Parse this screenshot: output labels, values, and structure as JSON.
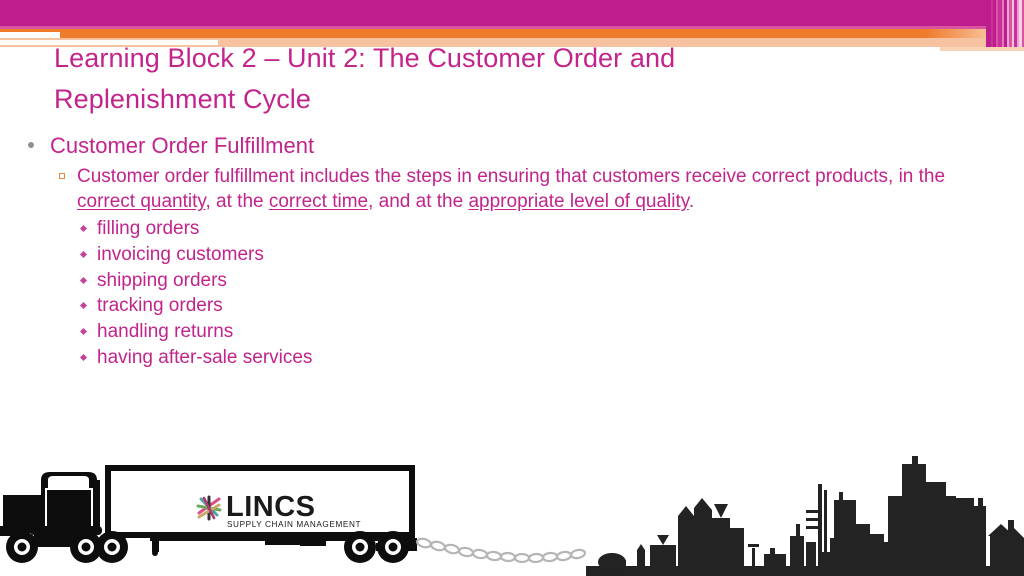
{
  "slide": {
    "title": "Learning Block 2 – Unit 2: The Customer Order and Replenishment Cycle",
    "title_color": "#C2248C"
  },
  "header": {
    "band_magenta_color": "#BE1E8D",
    "band_orange_color": "#EE7C2B",
    "band_peach_color": "#F6C2A0",
    "stripe_colors": [
      "#BE1E8D",
      "#C9309B",
      "#BE1E8D",
      "#D9559F",
      "#C9309B",
      "#E27DB8",
      "#BE1E8D",
      "#EFA9D0",
      "#D9559F",
      "#F3C2DF",
      "#C9309B",
      "#E9A0CC",
      "#F5D2E7",
      "#D9559F"
    ]
  },
  "content": {
    "level1": [
      {
        "text": "Customer Order Fulfillment",
        "bullet": "dot-bullet"
      }
    ],
    "level2": {
      "bullet": "square-bullet",
      "segments": [
        {
          "text": "Customer order fulfillment includes the steps in ensuring that customers receive correct products, in the ",
          "underline": false
        },
        {
          "text": "correct quantity",
          "underline": true
        },
        {
          "text": ", at the ",
          "underline": false
        },
        {
          "text": "correct time",
          "underline": true
        },
        {
          "text": ", and at the ",
          "underline": false
        },
        {
          "text": "appropriate level of quality",
          "underline": true
        },
        {
          "text": ".",
          "underline": false
        }
      ]
    },
    "level3": {
      "bullet": "diamond-bullet",
      "items": [
        "filling orders",
        "invoicing customers",
        "shipping orders",
        "tracking orders",
        "handling returns",
        "having after-sale services"
      ]
    }
  },
  "graphics": {
    "truck": {
      "name": "semi-truck-illustration",
      "color": "#0D0D0D"
    },
    "logo": {
      "name": "lincs-logo",
      "primary_text": "LINCS",
      "secondary_text": "SUPPLY CHAIN MANAGEMENT",
      "primary_color": "#1A1A1A",
      "mark_colors": [
        "#D94F86",
        "#6FA85A",
        "#4FA3A3",
        "#C9A96A",
        "#333333",
        "#B03A6E"
      ]
    },
    "chain": {
      "name": "chain-link-graphic",
      "color": "#B5B5B5"
    },
    "skyline": {
      "name": "city-skyline-silhouette",
      "color": "#232323"
    }
  }
}
